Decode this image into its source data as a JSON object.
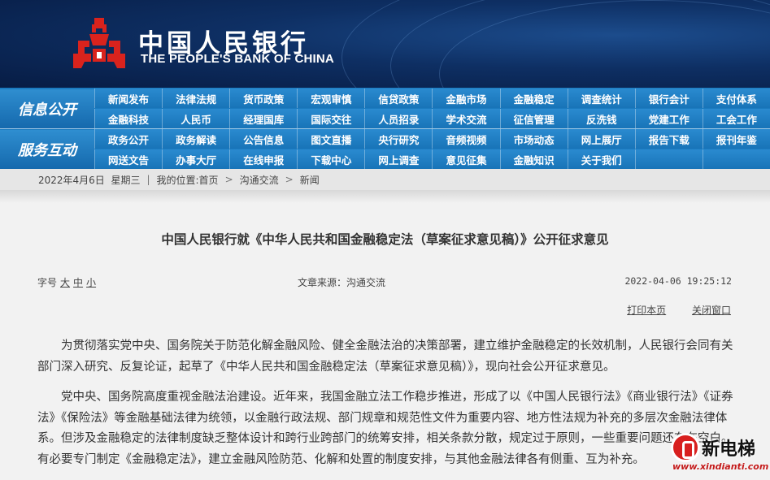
{
  "header": {
    "cn_name": "中国人民银行",
    "en_name": "THE PEOPLE'S BANK OF CHINA",
    "logo_icon": "pboc-logo-icon",
    "brand_color": "#d9231d"
  },
  "nav": {
    "label_1": "信息公开",
    "label_2": "服务互动",
    "rows": [
      [
        "新闻发布",
        "法律法规",
        "货币政策",
        "宏观审慎",
        "信贷政策",
        "金融市场",
        "金融稳定",
        "调查统计",
        "银行会计",
        "支付体系"
      ],
      [
        "金融科技",
        "人民币",
        "经理国库",
        "国际交往",
        "人员招录",
        "学术交流",
        "征信管理",
        "反洗钱",
        "党建工作",
        "工会工作"
      ],
      [
        "政务公开",
        "政务解读",
        "公告信息",
        "图文直播",
        "央行研究",
        "音频视频",
        "市场动态",
        "网上展厅",
        "报告下载",
        "报刊年鉴"
      ],
      [
        "网送文告",
        "办事大厅",
        "在线申报",
        "下载中心",
        "网上调查",
        "意见征集",
        "金融知识",
        "关于我们",
        "",
        ""
      ]
    ]
  },
  "breadcrumb": {
    "date": "2022年4月6日  星期三",
    "location_label": "我的位置:",
    "home": "首页",
    "level1": "沟通交流",
    "level2": "新闻",
    "separator": ">"
  },
  "article": {
    "title": "中国人民银行就《中华人民共和国金融稳定法（草案征求意见稿）》公开征求意见",
    "font_size_label": "字号",
    "font_large": "大",
    "font_medium": "中",
    "font_small": "小",
    "source": "文章来源：沟通交流",
    "datetime": "2022-04-06 19:25:12",
    "print_label": "打印本页",
    "close_label": "关闭窗口",
    "paragraphs": [
      "为贯彻落实党中央、国务院关于防范化解金融风险、健全金融法治的决策部署，建立维护金融稳定的长效机制，人民银行会同有关部门深入研究、反复论证，起草了《中华人民共和国金融稳定法（草案征求意见稿）》，现向社会公开征求意见。",
      "党中央、国务院高度重视金融法治建设。近年来，我国金融立法工作稳步推进，形成了以《中国人民银行法》《商业银行法》《证券法》《保险法》等金融基础法律为统领，以金融行政法规、部门规章和规范性文件为重要内容、地方性法规为补充的多层次金融法律体系。但涉及金融稳定的法律制度缺乏整体设计和跨行业跨部门的统筹安排，相关条款分散，规定过于原则，一些重要问题还存在空白。有必要专门制定《金融稳定法》，建立金融风险防范、化解和处置的制度安排，与其他金融法律各有侧重、互为补充。"
    ]
  },
  "watermark": {
    "text": "新电梯",
    "url": "www.xindianti.com"
  }
}
